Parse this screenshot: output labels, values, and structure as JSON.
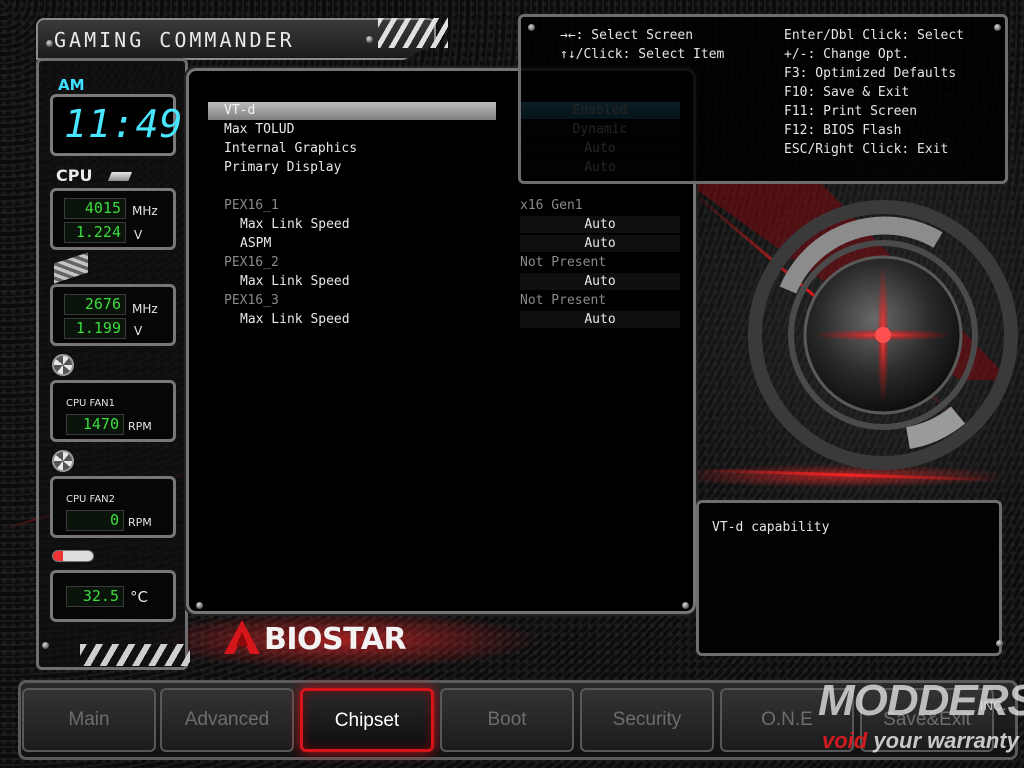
{
  "title": "GAMING COMMANDER",
  "brand": "BIOSTAR",
  "colors": {
    "accent_red": "#d4161b",
    "clock_cyan": "#49e6ff",
    "lcd_green": "#3ddc3d",
    "selection_blue": "#2a95c6"
  },
  "sidebar": {
    "clock_period": "AM",
    "clock_time": "11:49",
    "cpu_label": "CPU",
    "cpu_freq": "4015",
    "cpu_freq_unit": "MHz",
    "cpu_volt": "1.224",
    "cpu_volt_unit": "V",
    "mem_freq": "2676",
    "mem_freq_unit": "MHz",
    "mem_volt": "1.199",
    "mem_volt_unit": "V",
    "fan1_label": "CPU FAN1",
    "fan1_rpm": "1470",
    "fan1_unit": "RPM",
    "fan2_label": "CPU FAN2",
    "fan2_rpm": "0",
    "fan2_unit": "RPM",
    "temp": "32.5",
    "temp_unit": "°C",
    "icons": [
      "chip-icon",
      "memory-icon",
      "fan-icon",
      "fan-icon",
      "thermometer-icon"
    ]
  },
  "settings": [
    {
      "label": "VT-d",
      "value": "Enabled",
      "selected": true
    },
    {
      "label": "Max TOLUD",
      "value": "Dynamic"
    },
    {
      "label": "Internal Graphics",
      "value": "Auto"
    },
    {
      "label": "Primary Display",
      "value": "Auto"
    },
    {
      "label": "PEX16_1",
      "value": "x16  Gen1",
      "info": true
    },
    {
      "label": "Max Link Speed",
      "value": "Auto",
      "sub": true
    },
    {
      "label": "ASPM",
      "value": "Auto",
      "sub": true
    },
    {
      "label": "PEX16_2",
      "value": "Not Present",
      "info": true
    },
    {
      "label": "Max Link Speed",
      "value": "Auto",
      "sub": true
    },
    {
      "label": "PEX16_3",
      "value": "Not Present",
      "info": true
    },
    {
      "label": "Max Link Speed",
      "value": "Auto",
      "sub": true
    }
  ],
  "help": {
    "left": [
      "→←: Select Screen",
      "↑↓/Click: Select Item"
    ],
    "right": [
      "Enter/Dbl Click: Select",
      "+/-: Change Opt.",
      "F3: Optimized Defaults",
      "F10: Save & Exit",
      "F11: Print Screen",
      "F12: BIOS Flash",
      "ESC/Right Click: Exit"
    ]
  },
  "description": "VT-d capability",
  "tabs": [
    {
      "label": "Main"
    },
    {
      "label": "Advanced"
    },
    {
      "label": "Chipset",
      "active": true
    },
    {
      "label": "Boot"
    },
    {
      "label": "Security"
    },
    {
      "label": "O.N.E"
    },
    {
      "label": "Save&Exit"
    }
  ],
  "watermark": {
    "name": "MODDERS",
    "inc": "INC.",
    "tag_prefix": "void",
    "tag_suffix": " your warranty"
  }
}
